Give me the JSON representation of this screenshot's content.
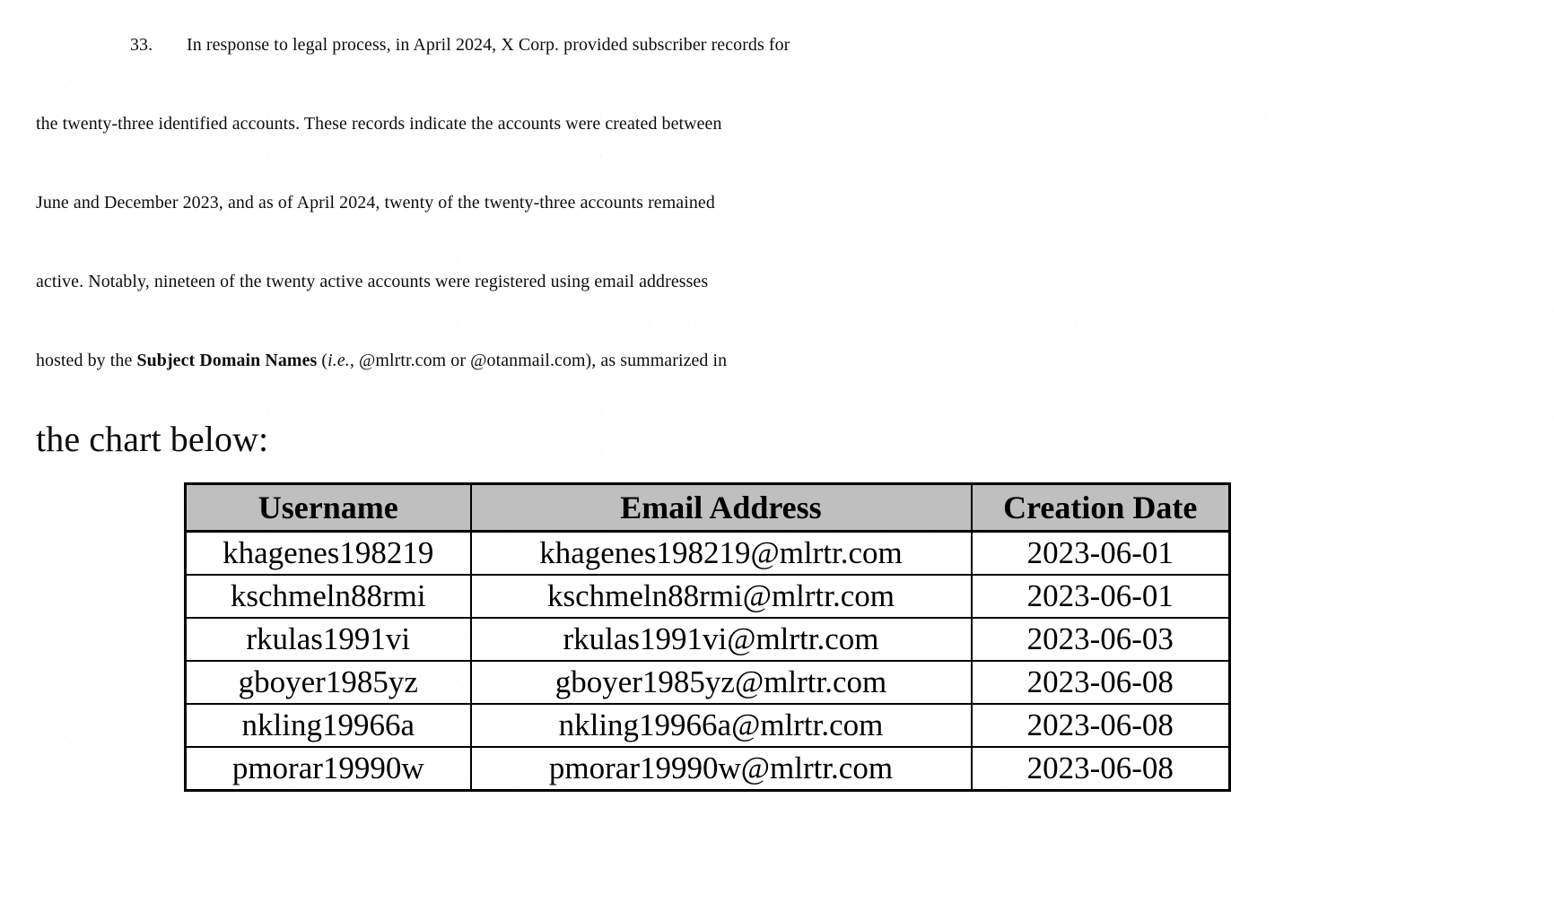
{
  "document": {
    "paragraph_number": "33.",
    "body_lines": [
      "In response to legal process, in April 2024, X Corp. provided subscriber records for",
      "the twenty-three identified accounts.  These records indicate the accounts were created between",
      "June and December 2023, and as of April 2024, twenty of the twenty-three accounts remained",
      "active.  Notably, nineteen of the twenty active accounts were registered using email addresses",
      "the chart below:"
    ],
    "line5": {
      "before_bold": "hosted by the ",
      "bold_term": "Subject Domain Names",
      "after_bold_open": " (",
      "italic_ie": "i.e.",
      "after_ie": ", @mlrtr.com or @otanmail.com), as summarized in"
    },
    "last_line": "the chart below:"
  },
  "table": {
    "headers": [
      "Username",
      "Email Address",
      "Creation Date"
    ],
    "rows": [
      {
        "username": "khagenes198219",
        "email": "khagenes198219@mlrtr.com",
        "created": "2023-06-01"
      },
      {
        "username": "kschmeln88rmi",
        "email": "kschmeln88rmi@mlrtr.com",
        "created": "2023-06-01"
      },
      {
        "username": "rkulas1991vi",
        "email": "rkulas1991vi@mlrtr.com",
        "created": "2023-06-03"
      },
      {
        "username": "gboyer1985yz",
        "email": "gboyer1985yz@mlrtr.com",
        "created": "2023-06-08"
      },
      {
        "username": "nkling19966a",
        "email": "nkling19966a@mlrtr.com",
        "created": "2023-06-08"
      },
      {
        "username": "pmorar19990w",
        "email": "pmorar19990w@mlrtr.com",
        "created": "2023-06-08"
      }
    ]
  },
  "colors": {
    "ink": "#0d0d0d",
    "page": "#ffffff",
    "header_fill": "#bfbfbf",
    "rule": "#000000"
  }
}
